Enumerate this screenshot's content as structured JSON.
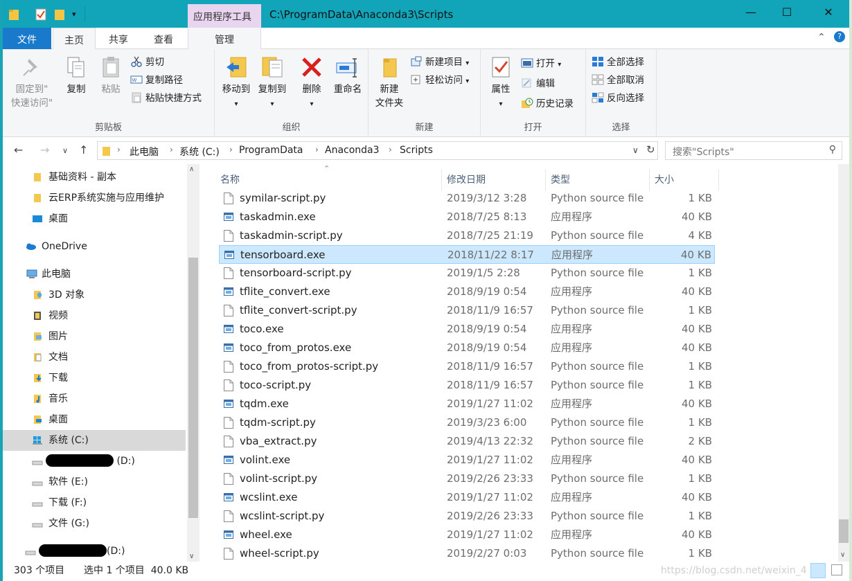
{
  "window": {
    "title": "C:\\ProgramData\\Anaconda3\\Scripts",
    "context_tab": "应用程序工具",
    "quick_access_items": [
      "folder-icon",
      "properties-check-icon",
      "new-folder-icon",
      "customize-dropdown-icon"
    ]
  },
  "ribbon_tabs": {
    "file": "文件",
    "home": "主页",
    "share": "共享",
    "view": "查看",
    "manage": "管理"
  },
  "ribbon": {
    "clipboard": {
      "label": "剪贴板",
      "pin": "固定到\"快速访问\"",
      "pin_line1": "固定到\"",
      "pin_line2": "快速访问\"",
      "copy": "复制",
      "paste": "粘贴",
      "cut": "剪切",
      "copy_path": "复制路径",
      "paste_shortcut": "粘贴快捷方式"
    },
    "organize": {
      "label": "组织",
      "move_to": "移动到",
      "copy_to": "复制到",
      "delete": "删除",
      "rename": "重命名"
    },
    "new": {
      "label": "新建",
      "new_folder_line1": "新建",
      "new_folder_line2": "文件夹",
      "new_item": "新建项目",
      "easy_access": "轻松访问"
    },
    "open": {
      "label": "打开",
      "properties": "属性",
      "open": "打开",
      "edit": "编辑",
      "history": "历史记录"
    },
    "select": {
      "label": "选择",
      "select_all": "全部选择",
      "select_none": "全部取消",
      "invert": "反向选择"
    }
  },
  "address": {
    "crumbs": [
      "此电脑",
      "系统 (C:)",
      "ProgramData",
      "Anaconda3",
      "Scripts"
    ],
    "search_placeholder": "搜索\"Scripts\""
  },
  "nav_pane": {
    "items": [
      {
        "label": "基础资料 - 副本",
        "icon": "folder-icon"
      },
      {
        "label": "云ERP系统实施与应用维护",
        "icon": "folder-icon"
      },
      {
        "label": "桌面",
        "icon": "desktop-icon"
      },
      {
        "label": "OneDrive",
        "icon": "cloud-icon"
      },
      {
        "label": "此电脑",
        "icon": "computer-icon"
      },
      {
        "label": "3D 对象",
        "icon": "3d-objects-icon"
      },
      {
        "label": "视频",
        "icon": "video-icon"
      },
      {
        "label": "图片",
        "icon": "pictures-icon"
      },
      {
        "label": "文档",
        "icon": "documents-icon"
      },
      {
        "label": "下载",
        "icon": "downloads-icon"
      },
      {
        "label": "音乐",
        "icon": "music-icon"
      },
      {
        "label": "桌面",
        "icon": "desktop-icon"
      },
      {
        "label": "系统 (C:)",
        "icon": "windows-drive-icon"
      },
      {
        "label": "(D:)",
        "icon": "drive-icon"
      },
      {
        "label": "软件 (E:)",
        "icon": "drive-icon"
      },
      {
        "label": "下载 (F:)",
        "icon": "drive-icon"
      },
      {
        "label": "文件 (G:)",
        "icon": "drive-icon"
      },
      {
        "label": "(D:)",
        "icon": "drive-icon"
      }
    ]
  },
  "columns": {
    "name": "名称",
    "date": "修改日期",
    "type": "类型",
    "size": "大小"
  },
  "files": [
    {
      "name": "symilar-script.py",
      "date": "2019/3/12 3:28",
      "type": "Python source file",
      "size": "1 KB",
      "kind": "py"
    },
    {
      "name": "taskadmin.exe",
      "date": "2018/7/25 8:13",
      "type": "应用程序",
      "size": "40 KB",
      "kind": "exe"
    },
    {
      "name": "taskadmin-script.py",
      "date": "2018/7/25 21:19",
      "type": "Python source file",
      "size": "4 KB",
      "kind": "py"
    },
    {
      "name": "tensorboard.exe",
      "date": "2018/11/22 8:17",
      "type": "应用程序",
      "size": "40 KB",
      "kind": "exe"
    },
    {
      "name": "tensorboard-script.py",
      "date": "2019/1/5 2:28",
      "type": "Python source file",
      "size": "1 KB",
      "kind": "py"
    },
    {
      "name": "tflite_convert.exe",
      "date": "2018/9/19 0:54",
      "type": "应用程序",
      "size": "40 KB",
      "kind": "exe"
    },
    {
      "name": "tflite_convert-script.py",
      "date": "2018/11/9 16:57",
      "type": "Python source file",
      "size": "1 KB",
      "kind": "py"
    },
    {
      "name": "toco.exe",
      "date": "2018/9/19 0:54",
      "type": "应用程序",
      "size": "40 KB",
      "kind": "exe"
    },
    {
      "name": "toco_from_protos.exe",
      "date": "2018/9/19 0:54",
      "type": "应用程序",
      "size": "40 KB",
      "kind": "exe"
    },
    {
      "name": "toco_from_protos-script.py",
      "date": "2018/11/9 16:57",
      "type": "Python source file",
      "size": "1 KB",
      "kind": "py"
    },
    {
      "name": "toco-script.py",
      "date": "2018/11/9 16:57",
      "type": "Python source file",
      "size": "1 KB",
      "kind": "py"
    },
    {
      "name": "tqdm.exe",
      "date": "2019/1/27 11:02",
      "type": "应用程序",
      "size": "40 KB",
      "kind": "exe"
    },
    {
      "name": "tqdm-script.py",
      "date": "2019/3/23 6:00",
      "type": "Python source file",
      "size": "1 KB",
      "kind": "py"
    },
    {
      "name": "vba_extract.py",
      "date": "2019/4/13 22:32",
      "type": "Python source file",
      "size": "2 KB",
      "kind": "py"
    },
    {
      "name": "volint.exe",
      "date": "2019/1/27 11:02",
      "type": "应用程序",
      "size": "40 KB",
      "kind": "exe"
    },
    {
      "name": "volint-script.py",
      "date": "2019/2/26 23:33",
      "type": "Python source file",
      "size": "1 KB",
      "kind": "py"
    },
    {
      "name": "wcslint.exe",
      "date": "2019/1/27 11:02",
      "type": "应用程序",
      "size": "40 KB",
      "kind": "exe"
    },
    {
      "name": "wcslint-script.py",
      "date": "2019/2/26 23:33",
      "type": "Python source file",
      "size": "1 KB",
      "kind": "py"
    },
    {
      "name": "wheel.exe",
      "date": "2019/1/27 11:02",
      "type": "应用程序",
      "size": "40 KB",
      "kind": "exe"
    },
    {
      "name": "wheel-script.py",
      "date": "2019/2/27 0:03",
      "type": "Python source file",
      "size": "1 KB",
      "kind": "py"
    }
  ],
  "selected_file": "tensorboard.exe",
  "status": {
    "count": "303 个项目",
    "selection": "选中 1 个项目  40.0 KB",
    "watermark": "https://blog.csdn.net/weixin_42..."
  },
  "colors": {
    "titlebar": "#12a5b9",
    "file_tab": "#1979ca",
    "context_tab": "#e9d5f0",
    "selection": "#cce8ff",
    "selection_border": "#99d1ff"
  }
}
